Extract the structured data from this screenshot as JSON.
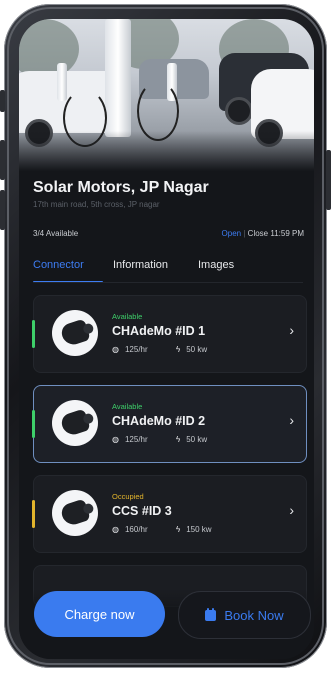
{
  "station": {
    "name": "Solar Motors, JP Nagar",
    "address": "17th main road, 5th cross, JP nagar",
    "availability": "3/4 Available",
    "open_label": "Open",
    "close_label": "Close 11:59 PM"
  },
  "tabs": [
    {
      "label": "Connector",
      "active": true
    },
    {
      "label": "Information",
      "active": false
    },
    {
      "label": "Images",
      "active": false
    }
  ],
  "connectors": [
    {
      "status": "Available",
      "status_color": "#3ecf6a",
      "name": "CHAdeMo #ID 1",
      "price": "125/hr",
      "power": "50 kw",
      "selected": false
    },
    {
      "status": "Available",
      "status_color": "#3ecf6a",
      "name": "CHAdeMo #ID 2",
      "price": "125/hr",
      "power": "50 kw",
      "selected": true
    },
    {
      "status": "Occupied",
      "status_color": "#e2b42c",
      "name": "CCS #ID 3",
      "price": "160/hr",
      "power": "150 kw",
      "selected": false
    }
  ],
  "icons": {
    "price": "coin-icon",
    "power": "lightning-icon",
    "chevron": "chevron-right-icon",
    "calendar": "calendar-icon"
  },
  "actions": {
    "charge_label": "Charge now",
    "book_label": "Book Now"
  },
  "colors": {
    "accent": "#3a7bef",
    "background": "#14161a",
    "available": "#3ecf6a",
    "occupied": "#e2b42c"
  }
}
